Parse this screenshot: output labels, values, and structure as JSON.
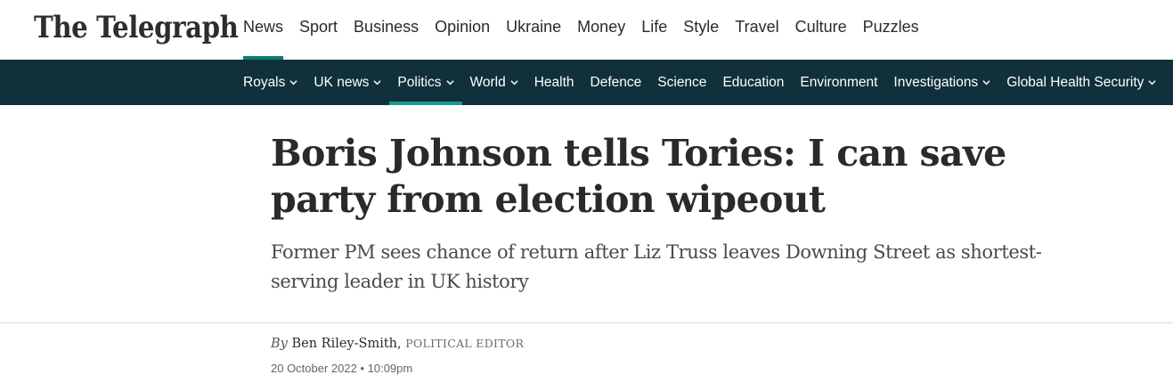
{
  "site": {
    "logo_text": "The Telegraph"
  },
  "primary_nav": [
    {
      "label": "News",
      "active": true
    },
    {
      "label": "Sport"
    },
    {
      "label": "Business"
    },
    {
      "label": "Opinion"
    },
    {
      "label": "Ukraine"
    },
    {
      "label": "Money"
    },
    {
      "label": "Life"
    },
    {
      "label": "Style"
    },
    {
      "label": "Travel"
    },
    {
      "label": "Culture"
    },
    {
      "label": "Puzzles"
    }
  ],
  "sub_nav": [
    {
      "label": "Royals",
      "dropdown": true
    },
    {
      "label": "UK news",
      "dropdown": true
    },
    {
      "label": "Politics",
      "dropdown": true,
      "active": true
    },
    {
      "label": "World",
      "dropdown": true
    },
    {
      "label": "Health"
    },
    {
      "label": "Defence"
    },
    {
      "label": "Science"
    },
    {
      "label": "Education"
    },
    {
      "label": "Environment"
    },
    {
      "label": "Investigations",
      "dropdown": true
    },
    {
      "label": "Global Health Security",
      "dropdown": true
    }
  ],
  "article": {
    "headline": "Boris Johnson tells Tories: I can save party from election wipeout",
    "standfirst": "Former PM sees chance of return after Liz Truss leaves Downing Street as shortest-serving leader in UK history",
    "byline_prefix": "By",
    "author": "Ben Riley-Smith,",
    "author_role": "POLITICAL EDITOR",
    "date": "20 October 2022 • 10:09pm"
  },
  "colors": {
    "sub_nav_bg": "#10303b",
    "accent": "#0c7a6e"
  }
}
